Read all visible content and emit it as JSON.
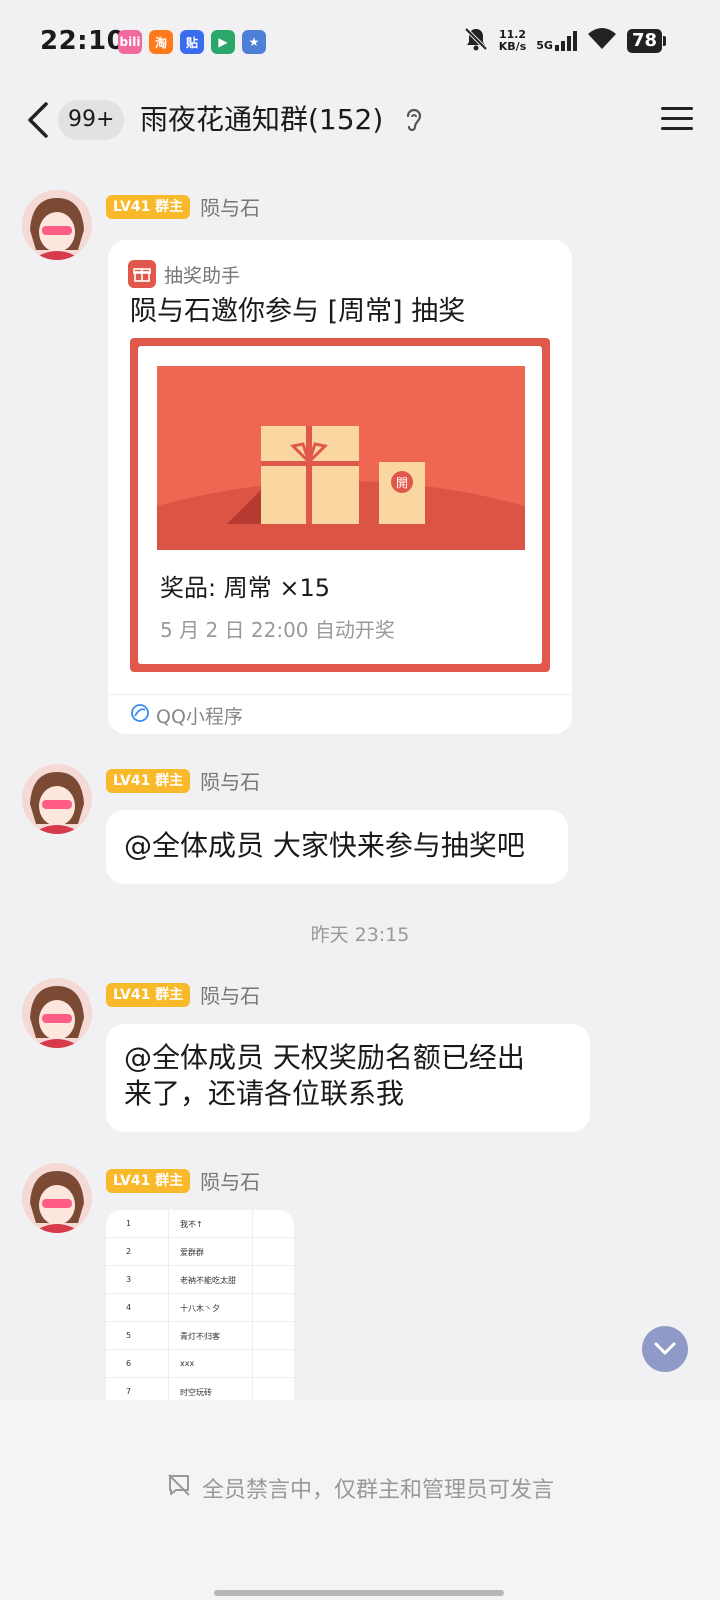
{
  "status_bar": {
    "time": "22:10",
    "app_icons": [
      {
        "name": "bilibili-icon",
        "label": "bili",
        "color": "#f06aa0"
      },
      {
        "name": "taobao-icon",
        "label": "淘",
        "color": "#ff7a1a"
      },
      {
        "name": "tieba-icon",
        "label": "贴",
        "color": "#3a6cf0"
      },
      {
        "name": "game-icon",
        "label": "▶",
        "color": "#2aa86a"
      },
      {
        "name": "avatar-app-icon",
        "label": "★",
        "color": "#4e7fd6"
      }
    ],
    "net_speed_value": "11.2",
    "net_speed_unit": "KB/s",
    "network": "5G",
    "battery": "78"
  },
  "header": {
    "unread_count": "99+",
    "title": "雨夜花通知群(152)"
  },
  "messages": [
    {
      "level": "LV41 群主",
      "sender": "陨与石",
      "card": {
        "app_name": "抽奖助手",
        "title": "陨与石邀你参与 [周常] 抽奖",
        "prize": "奖品: 周常 ×15",
        "draw_time": "5 月 2 日 22:00 自动开奖",
        "footer": "QQ小程序"
      }
    },
    {
      "level": "LV41 群主",
      "sender": "陨与石",
      "text": "@全体成员 大家快来参与抽奖吧"
    },
    {
      "level": "LV41 群主",
      "sender": "陨与石",
      "text_line1": "@全体成员 天权奖励名额已经出",
      "text_line2": "来了，还请各位联系我"
    },
    {
      "level": "LV41 群主",
      "sender": "陨与石",
      "image_rows": [
        {
          "n": "1",
          "name": "我不↑"
        },
        {
          "n": "2",
          "name": "爱群群"
        },
        {
          "n": "3",
          "name": "老衲不能吃太甜"
        },
        {
          "n": "4",
          "name": "十八木丶夕"
        },
        {
          "n": "5",
          "name": "青灯不归客"
        },
        {
          "n": "6",
          "name": "xxx"
        },
        {
          "n": "7",
          "name": "时空玩砖"
        }
      ]
    }
  ],
  "timestamp": "昨天 23:15",
  "bottom": {
    "muted_notice": "全员禁言中，仅群主和管理员可发言"
  },
  "colors": {
    "accent_red": "#e0584b",
    "level_badge": "#f8b92b",
    "scroll_button": "#8f9ac8"
  }
}
